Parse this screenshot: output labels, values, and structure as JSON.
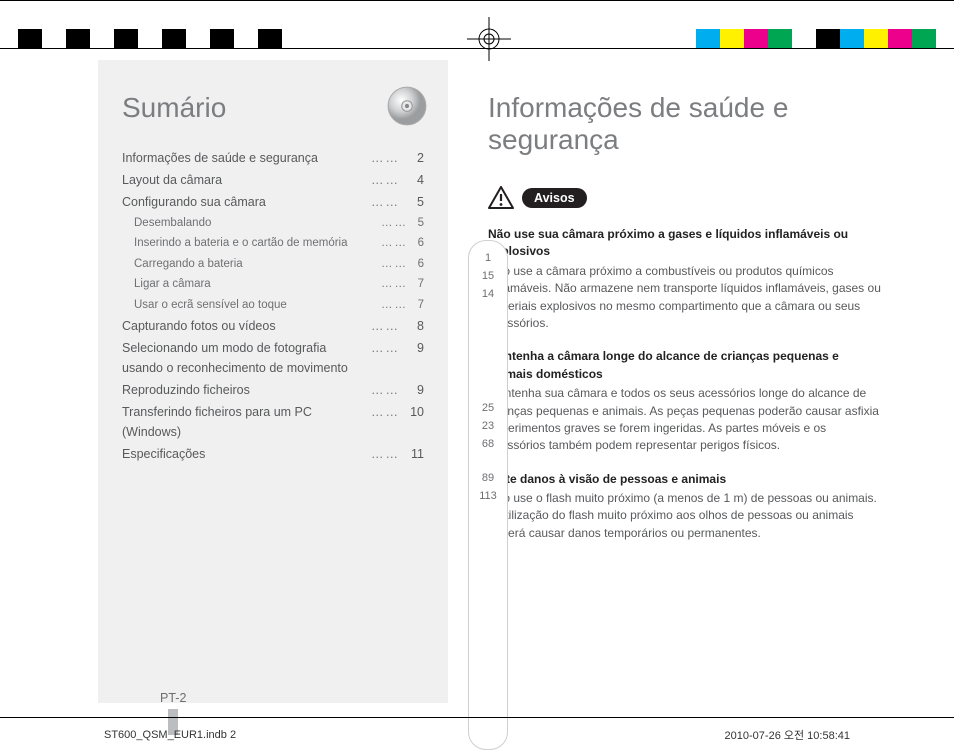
{
  "cal_colors_left": [
    "#000",
    "#fff",
    "#000",
    "#fff",
    "#000",
    "#fff",
    "#000",
    "#fff",
    "#000",
    "#fff",
    "#000"
  ],
  "cal_colors_right": [
    "#00aeef",
    "#fff100",
    "#ec008c",
    "#00a651",
    "#fff",
    "#000",
    "#00aeef",
    "#fff100",
    "#ec008c",
    "#00a651"
  ],
  "toc_title": "Sumário",
  "toc": [
    {
      "t": "Informações de saúde e segurança",
      "p": "2",
      "sub": []
    },
    {
      "t": "Layout da câmara",
      "p": "4",
      "sub": []
    },
    {
      "t": "Configurando sua câmara",
      "p": "5",
      "sub": [
        {
          "t": "Desembalando",
          "p": "5"
        },
        {
          "t": "Inserindo a bateria e o cartão de memória",
          "p": "6"
        },
        {
          "t": "Carregando a bateria",
          "p": "6"
        },
        {
          "t": "Ligar a câmara",
          "p": "7"
        },
        {
          "t": "Usar o ecrã sensível ao toque",
          "p": "7"
        }
      ]
    },
    {
      "t": "Capturando fotos ou vídeos",
      "p": "8",
      "sub": []
    },
    {
      "t": "Selecionando um modo de fotografia usando o reconhecimento de movimento",
      "p": "9",
      "sub": []
    },
    {
      "t": "Reproduzindo ficheiros",
      "p": "9",
      "sub": []
    },
    {
      "t": "Transferindo ficheiros para um PC (Windows)",
      "p": "10",
      "sub": []
    },
    {
      "t": "Especificações",
      "p": "11",
      "sub": []
    }
  ],
  "side_numbers": [
    "1",
    "15",
    "14",
    "25",
    "23",
    "68",
    "89",
    "113"
  ],
  "right_title": "Informações de saúde e segurança",
  "avisos_label": "Avisos",
  "blocks": [
    {
      "h": "Não use sua câmara próximo a gases e líquidos inflamáveis ou explosivos",
      "b": "Não use a câmara próximo a combustíveis ou produtos químicos inflamáveis. Não armazene nem transporte líquidos inflamáveis, gases ou materiais explosivos no mesmo compartimento que a câmara ou seus acessórios."
    },
    {
      "h": "Mantenha a câmara longe do alcance de crianças pequenas e animais domésticos",
      "b": "Mantenha sua câmara e todos os seus acessórios longe do alcance de crianças pequenas e animais. As peças pequenas poderão causar asfixia ou ferimentos graves se forem ingeridas. As partes móveis e os acessórios também podem representar perigos físicos."
    },
    {
      "h": "Evite danos à visão de pessoas e animais",
      "b": "Não use o flash muito próximo (a menos de 1 m) de pessoas ou animais. A utilização do flash muito próximo aos olhos de pessoas ou animais poderá causar danos temporários ou permanentes."
    }
  ],
  "page_mark": "PT-2",
  "foot_left": "ST600_QSM_EUR1.indb   2",
  "foot_right": "2010-07-26   오전 10:58:41"
}
